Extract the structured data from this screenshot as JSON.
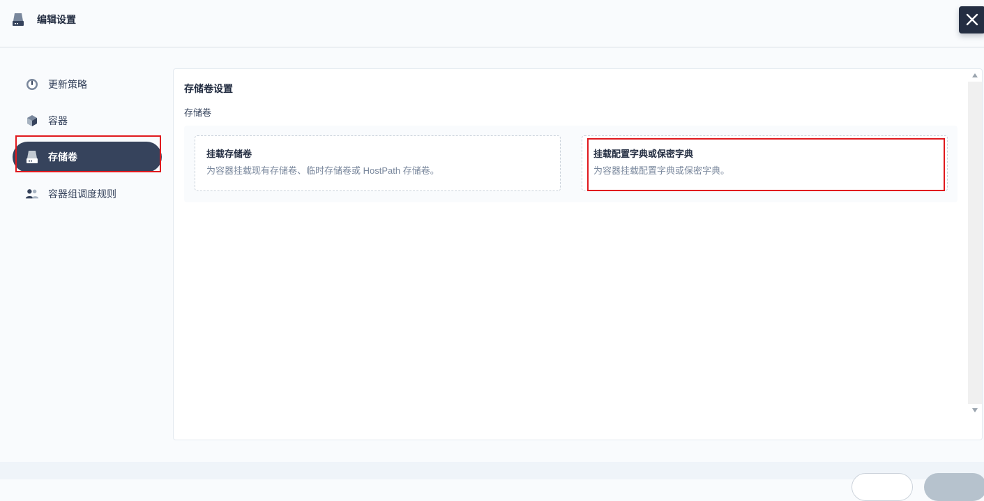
{
  "header": {
    "title": "编辑设置",
    "icon": "storage-icon",
    "close_icon": "close-icon"
  },
  "sidebar": {
    "items": [
      {
        "label": "更新策略",
        "icon": "update-strategy-icon"
      },
      {
        "label": "容器",
        "icon": "container-icon"
      },
      {
        "label": "存储卷",
        "icon": "storage-volume-icon",
        "active": true
      },
      {
        "label": "容器组调度规则",
        "icon": "pod-scheduling-icon"
      }
    ]
  },
  "main": {
    "title": "存储卷设置",
    "section_label": "存储卷",
    "options": [
      {
        "title": "挂载存储卷",
        "description": "为容器挂载现有存储卷、临时存储卷或 HostPath 存储卷。"
      },
      {
        "title": "挂载配置字典或保密字典",
        "description": "为容器挂载配置字典或保密字典。"
      }
    ]
  },
  "colors": {
    "accent": "#36435c",
    "highlight": "#e0191e",
    "dark": "#242e42"
  }
}
